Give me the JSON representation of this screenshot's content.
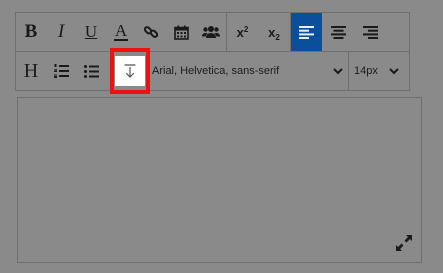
{
  "toolbar": {
    "row1": {
      "bold": "B",
      "italic": "I",
      "underline": "U",
      "text_color": "A",
      "superscript_base": "x",
      "superscript_mark": "2",
      "subscript_base": "x",
      "subscript_mark": "2"
    },
    "row2": {
      "heading": "H",
      "font_family": "Arial, Helvetica, sans-serif",
      "font_size": "14px"
    }
  },
  "icons": {
    "bold": "bold-icon",
    "italic": "italic-icon",
    "underline": "underline-icon",
    "text_color": "text-color-icon",
    "link": "link-icon",
    "calendar": "calendar-icon",
    "users": "users-icon",
    "superscript": "superscript-icon",
    "subscript": "subscript-icon",
    "align_left": "align-left-icon",
    "align_center": "align-center-icon",
    "align_right": "align-right-icon",
    "heading": "heading-icon",
    "ordered_list": "ordered-list-icon",
    "bullet_list": "bullet-list-icon",
    "insert_below": "insert-below-icon",
    "expand": "expand-icon"
  },
  "colors": {
    "background": "#8a8a8a",
    "border": "#6f6f6f",
    "active": "#0a4f9b",
    "highlight": "#ee1111"
  }
}
